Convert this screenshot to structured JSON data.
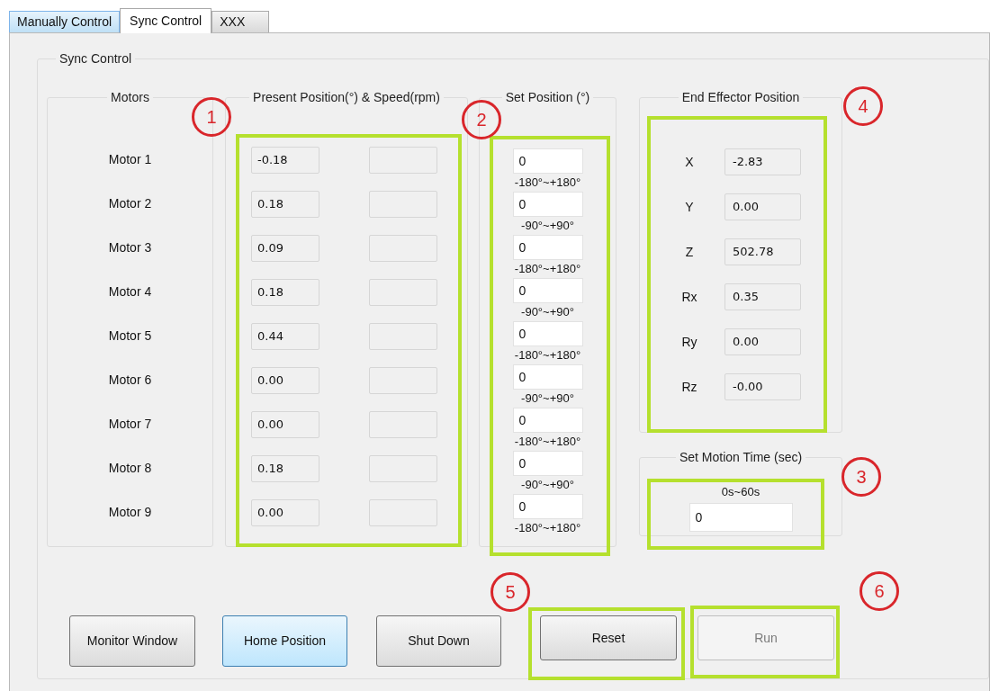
{
  "tabs": [
    {
      "label": "Manually Control",
      "selected": false,
      "hovered": true
    },
    {
      "label": "Sync Control",
      "selected": true,
      "hovered": false
    },
    {
      "label": "XXX",
      "selected": false,
      "hovered": false
    }
  ],
  "group_title": "Sync Control",
  "motors": {
    "title": "Motors",
    "items": [
      "Motor 1",
      "Motor 2",
      "Motor 3",
      "Motor 4",
      "Motor 5",
      "Motor 6",
      "Motor 7",
      "Motor 8",
      "Motor 9"
    ]
  },
  "present": {
    "title": "Present Position(°) & Speed(rpm)",
    "positions": [
      "-0.18",
      "0.18",
      "0.09",
      "0.18",
      "0.44",
      "0.00",
      "0.00",
      "0.18",
      "0.00"
    ]
  },
  "set_position": {
    "title": "Set Position (°)",
    "items": [
      {
        "value": "0",
        "range": "-180°~+180°"
      },
      {
        "value": "0",
        "range": "-90°~+90°"
      },
      {
        "value": "0",
        "range": "-180°~+180°"
      },
      {
        "value": "0",
        "range": "-90°~+90°"
      },
      {
        "value": "0",
        "range": "-180°~+180°"
      },
      {
        "value": "0",
        "range": "-90°~+90°"
      },
      {
        "value": "0",
        "range": "-180°~+180°"
      },
      {
        "value": "0",
        "range": "-90°~+90°"
      },
      {
        "value": "0",
        "range": "-180°~+180°"
      }
    ]
  },
  "end_effector": {
    "title": "End Effector Position",
    "rows": [
      {
        "axis": "X",
        "value": "-2.83"
      },
      {
        "axis": "Y",
        "value": "0.00"
      },
      {
        "axis": "Z",
        "value": "502.78"
      },
      {
        "axis": "Rx",
        "value": "0.35"
      },
      {
        "axis": "Ry",
        "value": "0.00"
      },
      {
        "axis": "Rz",
        "value": "-0.00"
      }
    ]
  },
  "motion_time": {
    "title": "Set Motion Time (sec)",
    "range": "0s~60s",
    "value": "0"
  },
  "buttons": [
    {
      "label": "Monitor Window",
      "focused": false,
      "disabled": false
    },
    {
      "label": "Home Position",
      "focused": true,
      "disabled": false
    },
    {
      "label": "Shut Down",
      "focused": false,
      "disabled": false
    },
    {
      "label": "Reset",
      "focused": false,
      "disabled": false
    },
    {
      "label": "Run",
      "focused": false,
      "disabled": true
    }
  ],
  "callouts": [
    "1",
    "2",
    "3",
    "4",
    "5",
    "6"
  ]
}
